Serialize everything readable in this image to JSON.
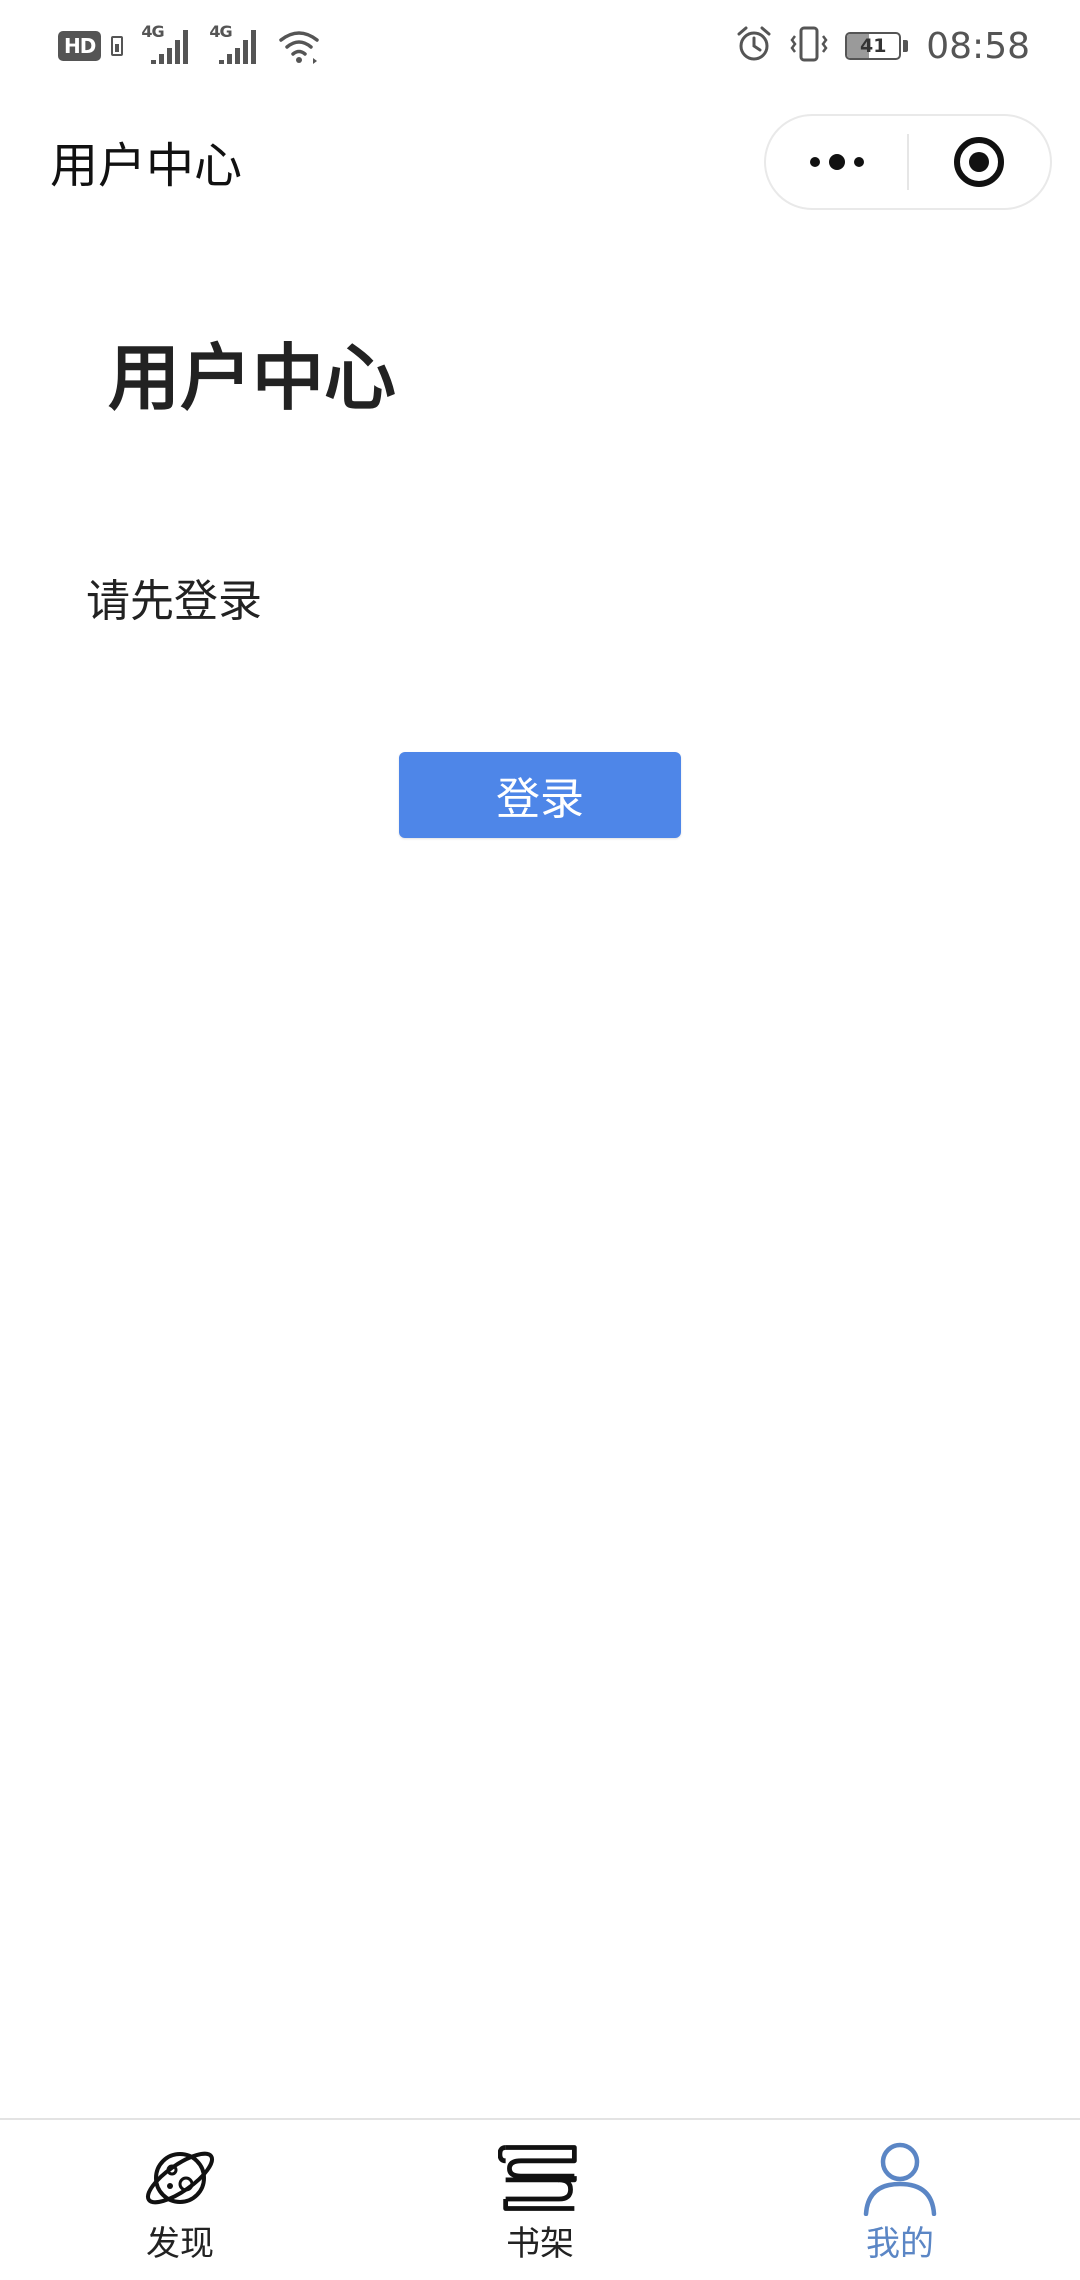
{
  "status_bar": {
    "hd_label": "HD",
    "signal_1_label": "4G",
    "signal_2_label": "4G",
    "battery_level": "41",
    "battery_fraction": 0.41,
    "time": "08:58",
    "icons": [
      "sim-icon",
      "signal-icon",
      "wifi-icon",
      "alarm-icon",
      "vibrate-icon",
      "battery-icon"
    ]
  },
  "nav": {
    "title": "用户中心",
    "more_icon": "more-dots-icon",
    "close_icon": "target-circle-icon"
  },
  "main": {
    "heading": "用户中心",
    "hint": "请先登录",
    "login_button": "登录"
  },
  "tabbar": {
    "items": [
      {
        "label": "发现",
        "icon": "planet-icon",
        "active": false
      },
      {
        "label": "书架",
        "icon": "bookshelf-icon",
        "active": false
      },
      {
        "label": "我的",
        "icon": "user-icon",
        "active": true
      }
    ]
  },
  "colors": {
    "accent_button": "#4e86e8",
    "active_tab": "#5b86c5",
    "text_primary": "#222222"
  }
}
